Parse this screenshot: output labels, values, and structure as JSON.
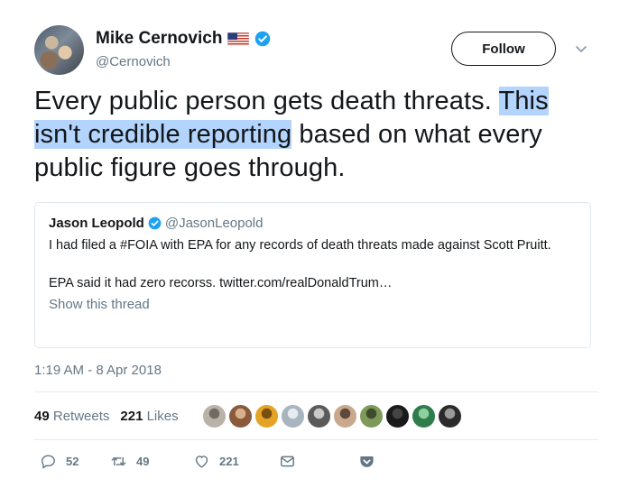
{
  "author": {
    "display_name": "Mike Cernovich",
    "handle": "@Cernovich",
    "avatar": "profile-photo",
    "flag": "us-flag-icon",
    "verified": true
  },
  "follow_label": "Follow",
  "tweet": {
    "text_before": "Every public person gets death threats. ",
    "text_highlighted": "This isn't credible reporting",
    "text_after": " based on what every public figure goes through."
  },
  "quoted_tweet": {
    "name": "Jason Leopold",
    "handle": "@JasonLeopold",
    "verified": true,
    "paragraph_1": "I had filed a #FOIA with EPA for any records of death threats made against Scott Pruitt.",
    "paragraph_2": "EPA said it had zero recorss. twitter.com/realDonaldTrum…",
    "show_thread": "Show this thread"
  },
  "timestamp": "1:19 AM - 8 Apr 2018",
  "stats": {
    "retweets_count": "49",
    "retweets_label": "Retweets",
    "likes_count": "221",
    "likes_label": "Likes"
  },
  "likers": [
    {
      "color": "#b9b2a8",
      "alt": "#6f6a63"
    },
    {
      "color": "#8a5a3c",
      "alt": "#d9b08c"
    },
    {
      "color": "#e5a325",
      "alt": "#7a4e12"
    },
    {
      "color": "#a8b4bf",
      "alt": "#e7ecf0"
    },
    {
      "color": "#5b5b5b",
      "alt": "#c9c9c9"
    },
    {
      "color": "#c9a98d",
      "alt": "#5e4a3b"
    },
    {
      "color": "#7e9a5a",
      "alt": "#3e4b2d"
    },
    {
      "color": "#1a1a1a",
      "alt": "#444444"
    },
    {
      "color": "#2f7d4a",
      "alt": "#8fd0a1"
    },
    {
      "color": "#2b2b2b",
      "alt": "#9a9a9a"
    }
  ],
  "actions": {
    "reply_count": "52",
    "retweet_count": "49",
    "like_count": "221"
  },
  "colors": {
    "text": "#14171a",
    "secondary": "#657786",
    "verified": "#1da1f2",
    "highlight": "#b3d4fc",
    "border": "#e1e8ed"
  }
}
